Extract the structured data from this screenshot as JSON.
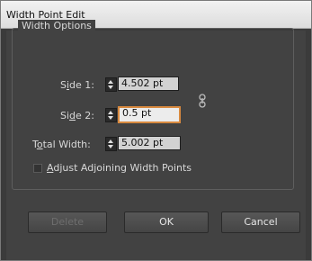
{
  "dialog": {
    "title": "Width Point Edit"
  },
  "width_options": {
    "legend": "Width Options",
    "side1": {
      "label_prefix": "S",
      "label_accel": "i",
      "label_suffix": "de 1:",
      "value": "4.502 pt"
    },
    "side2": {
      "label_prefix": "Si",
      "label_accel": "d",
      "label_suffix": "e 2:",
      "value": "0.5 pt"
    },
    "total": {
      "label_prefix": "T",
      "label_accel": "o",
      "label_suffix": "tal Width:",
      "value": "5.002 pt"
    },
    "adjust": {
      "label_accel": "A",
      "label_suffix": "djust Adjoining Width Points",
      "checked": false
    },
    "link_icon": "link-chain-icon"
  },
  "buttons": {
    "delete": "Delete",
    "ok": "OK",
    "cancel": "Cancel"
  },
  "colors": {
    "panel_bg": "#424242",
    "active_field_border": "#d98a3f"
  }
}
